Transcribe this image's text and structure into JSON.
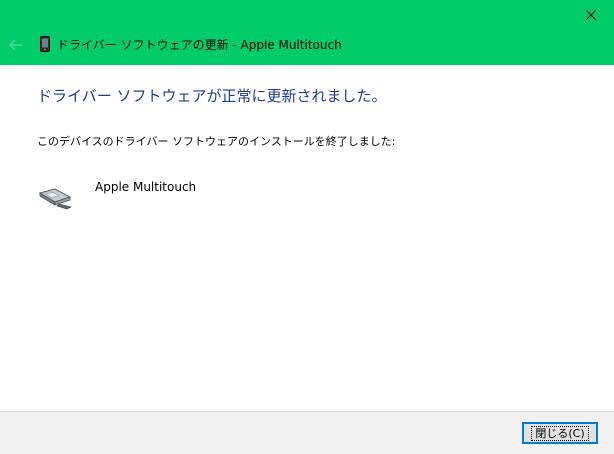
{
  "window": {
    "title": "ドライバー ソフトウェアの更新 - Apple Multitouch",
    "accent_color": "#00cc6a"
  },
  "icons": {
    "titlebar_close": "close-icon",
    "back": "back-arrow-icon",
    "title": "device-phone-icon",
    "device": "multitouch-device-icon"
  },
  "main": {
    "heading": "ドライバー ソフトウェアが正常に更新されました。",
    "message": "このデバイスのドライバー ソフトウェアのインストールを終了しました:",
    "device_name": "Apple Multitouch"
  },
  "footer": {
    "close_label": "閉じる(C)"
  }
}
